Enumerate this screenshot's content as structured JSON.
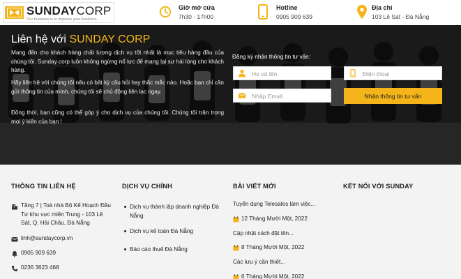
{
  "header": {
    "logo": {
      "name_bold": "SUNDAY",
      "name_thin": "CORP",
      "tagline": "Our business is to improve your business"
    },
    "hours": {
      "title": "Giờ mở cửa",
      "value": "7h30 - 17h00",
      "icon": "clock-icon"
    },
    "hotline": {
      "title": "Hotline",
      "value": "0905 909 639",
      "icon": "phone-icon"
    },
    "address": {
      "title": "Địa chỉ",
      "value": "103 Lê Sát - Đà Nẵng",
      "icon": "location-pin-icon"
    }
  },
  "hero": {
    "title_prefix": "Liên hệ với ",
    "title_brand": "SUNDAY CORP",
    "paragraph1": "Mang đến cho khách hàng chất lượng dịch vụ tốt nhất là mục tiêu hàng đầu của chúng tôi. Sunday corp luôn không ngừng nổ lực để mang lại sự hài lòng cho khách hàng.",
    "paragraph2": "Hãy liên hệ với chúng tôi nếu có bất kỳ câu hỏi hay thắc mắc nào. Hoặc bạn chỉ cần gửi thông tin của mình, chúng tôi sẽ chủ động liên lạc ngay.",
    "paragraph3": "Đồng thời, bạn cũng có thể góp ý cho dịch vụ của chúng tôi. Chúng tôi trân trọng mọi ý kiến của bạn !",
    "form": {
      "title": "Đăng ký nhận thông tin tư vấn:",
      "name_placeholder": "Họ và tên",
      "phone_placeholder": "Điện thoại",
      "email_placeholder": "Nhập Email",
      "submit_label": "Nhận thông tin tư vấn"
    }
  },
  "footer": {
    "contact": {
      "title": "THÔNG TIN LIÊN HỆ",
      "address": "Tầng 7 | Toà nhà Bộ Kế Hoạch Đầu Tư khu vực miền Trung - 103 Lê Sát, Q. Hải Châu, Đà Nẵng",
      "email": "linh@sundaycorp.vn",
      "phone1": "0905 909 639",
      "phone2": "0236 3623 468"
    },
    "services": {
      "title": "DỊCH VỤ CHÍNH",
      "items": [
        "Dịch vụ thành lập doanh nghiệp Đà Nẵng",
        "Dịch vụ kế toán Đà Nẵng",
        "Báo cáo thuế Đà Nẵng"
      ]
    },
    "posts": {
      "title": "BÀI VIẾT MỚI",
      "items": [
        {
          "title": "Tuyển dụng Telesales làm việc...",
          "date": "12 Tháng Mười Một, 2022"
        },
        {
          "title": "Cập nhật cách đặt tên...",
          "date": "8 Tháng Mười Một, 2022"
        },
        {
          "title": "Các lưu ý cần thiết...",
          "date": "6 Tháng Mười Một, 2022"
        }
      ]
    },
    "social": {
      "title": "KẾT NỐI VỚI SUNDAY"
    }
  },
  "colors": {
    "accent": "#f4b41a",
    "footer_bg": "#f3f3f3",
    "hero_overlay": "#000000"
  }
}
